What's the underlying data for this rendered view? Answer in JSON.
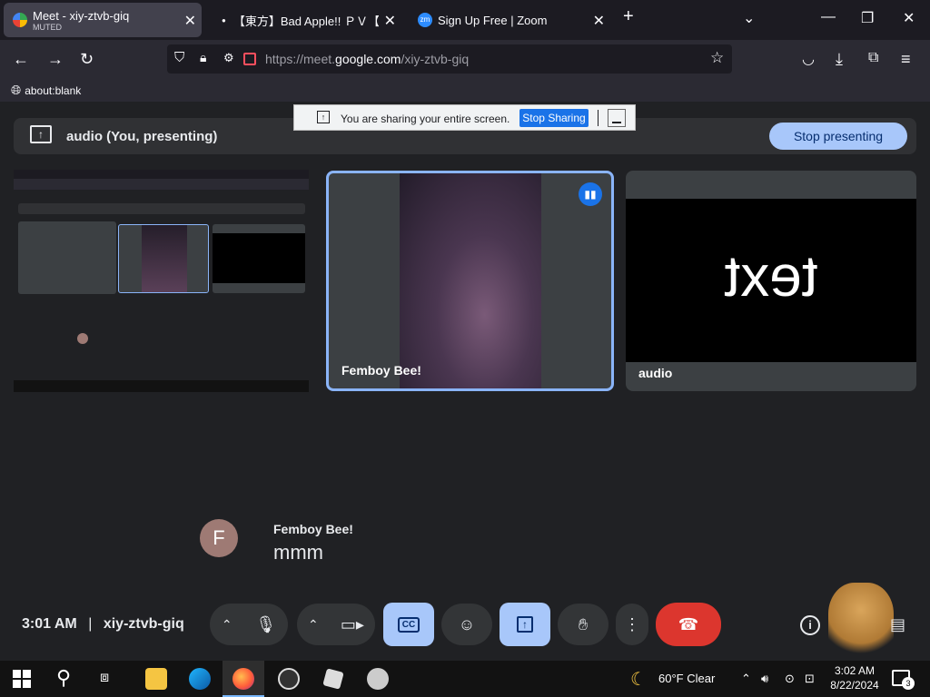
{
  "browser": {
    "tabs": [
      {
        "title": "Meet - xiy-ztvb-giq",
        "subtitle": "MUTED",
        "active": true
      },
      {
        "title": "【東方】Bad Apple!! ＰＶ【影絵】",
        "active": false
      },
      {
        "title": "Sign Up Free | Zoom",
        "active": false
      }
    ],
    "url_prefix": "https://meet.",
    "url_domain": "google.com",
    "url_path": "/xiy-ztvb-giq",
    "bookmark": "about:blank"
  },
  "share_notice": {
    "text": "You are sharing your entire screen.",
    "stop_label": "Stop Sharing"
  },
  "meet": {
    "present_label": "audio (You, presenting)",
    "stop_presenting_label": "Stop presenting",
    "tiles": [
      {
        "name": "Femboy Bee!"
      },
      {
        "name": "audio",
        "screen_text": "text"
      }
    ],
    "speaker": {
      "initial": "F",
      "name": "Femboy Bee!",
      "caption": "mmm"
    },
    "time": "3:01 AM",
    "code": "xiy-ztvb-giq"
  },
  "taskbar": {
    "weather": "60°F  Clear",
    "time": "3:02 AM",
    "date": "8/22/2024",
    "notifications": "3"
  }
}
